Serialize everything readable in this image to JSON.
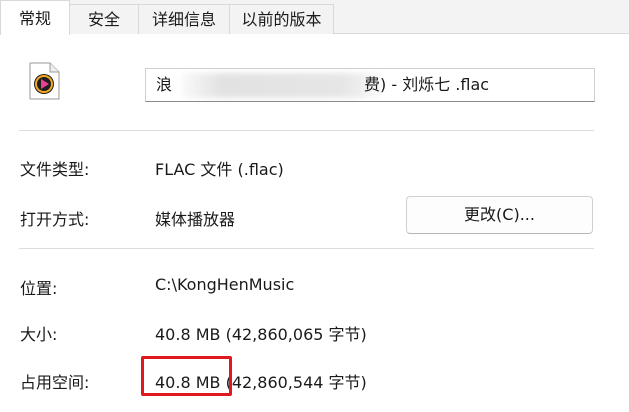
{
  "tabs": [
    {
      "label": "常规",
      "active": true
    },
    {
      "label": "安全",
      "active": false
    },
    {
      "label": "详细信息",
      "active": false
    },
    {
      "label": "以前的版本",
      "active": false
    }
  ],
  "file": {
    "icon": "media-player-file-icon",
    "name_prefix": "浪",
    "name_suffix": "费) - 刘烁七 .flac"
  },
  "rows": {
    "type": {
      "label": "文件类型:",
      "value": "FLAC 文件 (.flac)"
    },
    "opens_with": {
      "label": "打开方式:",
      "value": "媒体播放器",
      "change_button": "更改(C)..."
    },
    "location": {
      "label": "位置:",
      "value": "C:\\KongHenMusic"
    },
    "size": {
      "label": "大小:",
      "value": "40.8 MB (42,860,065 字节)"
    },
    "size_on_disk": {
      "label": "占用空间:",
      "value": "40.8 MB (42,860,544 字节)"
    }
  },
  "colors": {
    "highlight": "#e0191e",
    "icon_accent": "#f5a623"
  }
}
